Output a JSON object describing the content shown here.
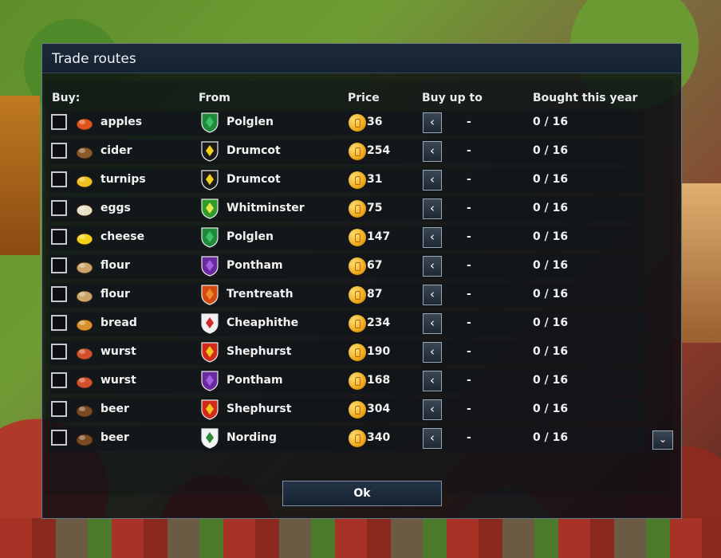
{
  "dialog": {
    "title": "Trade routes",
    "ok_label": "Ok",
    "headers": {
      "buy": "Buy:",
      "from": "From",
      "price": "Price",
      "buy_up_to": "Buy up to",
      "bought": "Bought this year"
    },
    "rows": [
      {
        "good": "apples",
        "town": "Polglen",
        "price": "36",
        "buy_up_to": "-",
        "bought": "0 / 16",
        "checked": false
      },
      {
        "good": "cider",
        "town": "Drumcot",
        "price": "254",
        "buy_up_to": "-",
        "bought": "0 / 16",
        "checked": false
      },
      {
        "good": "turnips",
        "town": "Drumcot",
        "price": "31",
        "buy_up_to": "-",
        "bought": "0 / 16",
        "checked": false
      },
      {
        "good": "eggs",
        "town": "Whitminster",
        "price": "75",
        "buy_up_to": "-",
        "bought": "0 / 16",
        "checked": false
      },
      {
        "good": "cheese",
        "town": "Polglen",
        "price": "147",
        "buy_up_to": "-",
        "bought": "0 / 16",
        "checked": false
      },
      {
        "good": "flour",
        "town": "Pontham",
        "price": "67",
        "buy_up_to": "-",
        "bought": "0 / 16",
        "checked": false
      },
      {
        "good": "flour",
        "town": "Trentreath",
        "price": "87",
        "buy_up_to": "-",
        "bought": "0 / 16",
        "checked": false
      },
      {
        "good": "bread",
        "town": "Cheaphithe",
        "price": "234",
        "buy_up_to": "-",
        "bought": "0 / 16",
        "checked": false
      },
      {
        "good": "wurst",
        "town": "Shephurst",
        "price": "190",
        "buy_up_to": "-",
        "bought": "0 / 16",
        "checked": false
      },
      {
        "good": "wurst",
        "town": "Pontham",
        "price": "168",
        "buy_up_to": "-",
        "bought": "0 / 16",
        "checked": false
      },
      {
        "good": "beer",
        "town": "Shephurst",
        "price": "304",
        "buy_up_to": "-",
        "bought": "0 / 16",
        "checked": false
      },
      {
        "good": "beer",
        "town": "Nording",
        "price": "340",
        "buy_up_to": "-",
        "bought": "0 / 16",
        "checked": false
      }
    ]
  },
  "icons": {
    "decrease": "chevron-left-icon",
    "scroll": "chevron-down-icon",
    "coin": "gold-coin-icon"
  },
  "colors": {
    "goods": {
      "apples": "#e0531c",
      "cider": "#8a5a2b",
      "turnips": "#f0c020",
      "eggs": "#e8e0c8",
      "cheese": "#f5d21a",
      "flour": "#c9a56a",
      "bread": "#d7902c",
      "wurst": "#d2502a",
      "beer": "#7a4a22"
    },
    "crests": {
      "Polglen": [
        "#1f8a3a",
        "#3ec06a"
      ],
      "Drumcot": [
        "#1a1a1a",
        "#f4d21c"
      ],
      "Whitminster": [
        "#2e9b2a",
        "#e2e84a"
      ],
      "Pontham": [
        "#6a2aa0",
        "#a35fe0"
      ],
      "Trentreath": [
        "#d24a12",
        "#f08a2a"
      ],
      "Cheaphithe": [
        "#f0f0f0",
        "#d22a2a"
      ],
      "Shephurst": [
        "#d22a1a",
        "#f4c81c"
      ],
      "Nording": [
        "#f4f4f4",
        "#2a8a3a"
      ]
    }
  }
}
